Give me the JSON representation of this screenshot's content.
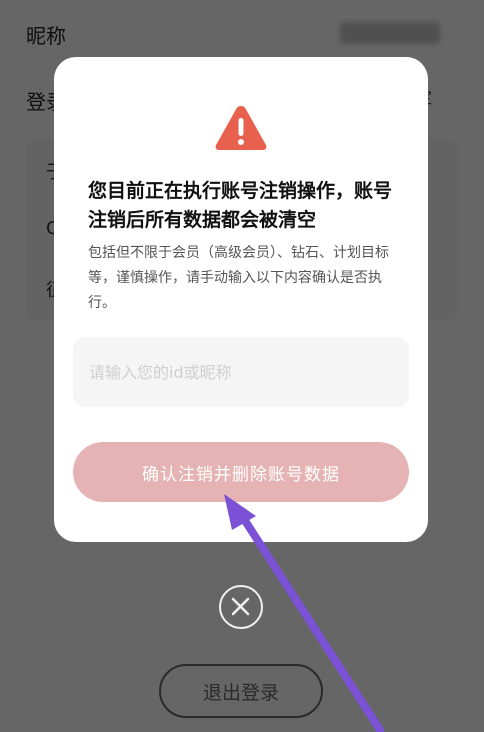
{
  "background": {
    "nickname_label": "昵称",
    "login_label": "登录",
    "login_value": "绑定",
    "card_rows": [
      "于",
      "C",
      "征"
    ]
  },
  "dialog": {
    "icon": "warning-triangle-icon",
    "title": "您目前正在执行账号注销操作，账号注销后所有数据都会被清空",
    "description": "包括但不限于会员（高级会员）、钻石、计划目标等，谨慎操作，请手动输入以下内容确认是否执行。",
    "input": {
      "value": "",
      "placeholder": "请输入您的id或昵称"
    },
    "confirm_label": "确认注销并删除账号数据"
  },
  "close_icon": "close-icon",
  "logout_label": "退出登录",
  "colors": {
    "warning": "#e8614f",
    "confirm_button_bg": "#e5b3b3",
    "annotation_arrow": "#7b52d6",
    "overlay": "#6b6b6b"
  }
}
